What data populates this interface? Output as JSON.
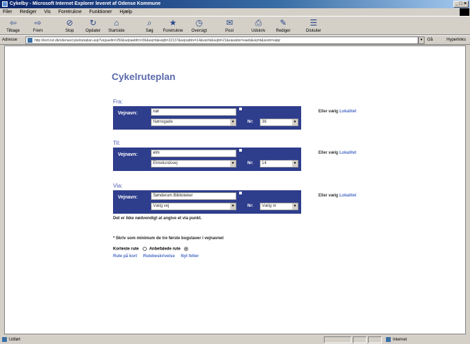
{
  "window": {
    "title": "Cykelby - Microsoft Internet Explorer leveret af Odense Kommune",
    "controls": "_ □ ×"
  },
  "menu": [
    "Filer",
    "Rediger",
    "Vis",
    "Foretrukne",
    "Funktioner",
    "Hjælp"
  ],
  "toolbar": [
    {
      "label": "Tilbage",
      "icon": "back-arrow-icon",
      "glyph": "⇦"
    },
    {
      "label": "Frem",
      "icon": "forward-arrow-icon",
      "glyph": "⇨"
    },
    {
      "label": "Stop",
      "icon": "stop-icon",
      "glyph": "⊘"
    },
    {
      "label": "Opdater",
      "icon": "refresh-icon",
      "glyph": "↻"
    },
    {
      "label": "Startside",
      "icon": "home-icon",
      "glyph": "⌂"
    },
    {
      "label": "Søg",
      "icon": "search-icon",
      "glyph": "⌕"
    },
    {
      "label": "Foretrukne",
      "icon": "favorites-icon",
      "glyph": "★"
    },
    {
      "label": "Oversigt",
      "icon": "history-icon",
      "glyph": "◷"
    },
    {
      "label": "Post",
      "icon": "mail-icon",
      "glyph": "✉"
    },
    {
      "label": "Udskriv",
      "icon": "print-icon",
      "glyph": "⎙"
    },
    {
      "label": "Rediger",
      "icon": "edit-icon",
      "glyph": "✎"
    },
    {
      "label": "Diskuter",
      "icon": "discuss-icon",
      "glyph": "☰"
    }
  ],
  "address": {
    "label": "Adresse",
    "url": "http://kort.kvt.dk/odense/cykelruteplan.asp?vejsaeltn=250&vejnaebfrn=36&vej=b&vejbt=22137&vejnabtnr=14&vej=b&vejbt=21&vaeabnr=vaeb&vej=b&sevb=valpr",
    "go": "Gå",
    "links": "Hyperlinks"
  },
  "page": {
    "title": "Cykelruteplan",
    "label_vejnavn": "Vejnavn:",
    "label_nr": "Nr:",
    "eller_prefix": "Eller vælg",
    "eller_link": "Lokalitet",
    "fra": {
      "heading": "Fra:",
      "street_input": "nør",
      "street_select": "Nørregade",
      "nr_select": "36"
    },
    "til": {
      "heading": "Til:",
      "street_input": "elm",
      "street_select": "Elmelundsvej",
      "nr_select": "14"
    },
    "via": {
      "heading": "Via:",
      "street_input": "Sønderum Biblioteker",
      "street_select": "Vælg vej",
      "nr_select": "Vælg nr"
    },
    "via_note": "Det er ikke nødvendigt at angive et via punkt.",
    "hint": "* Skriv som minimum de tre første bogstaver i vejnavnet",
    "shortest_label": "Korteste rute",
    "recommended_label": "Anbefalede rute",
    "links": [
      "Rute på kort",
      "Rutebeskrivelse",
      "Nyt felter"
    ]
  },
  "status": {
    "left": "Udført",
    "zone": "Internet"
  }
}
